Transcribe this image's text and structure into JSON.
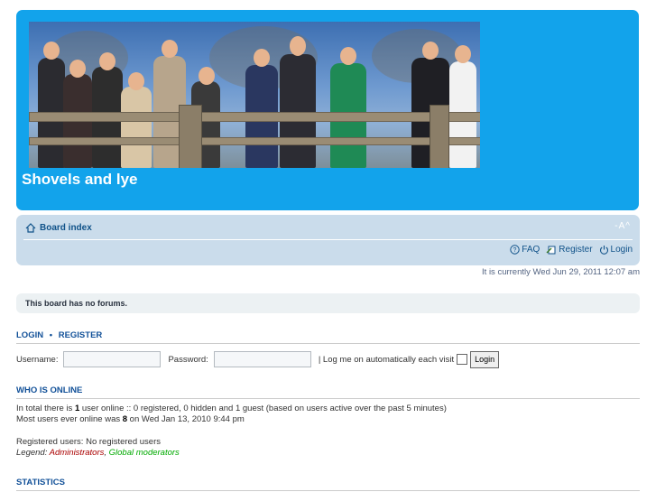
{
  "header": {
    "site_title": "Shovels and lye"
  },
  "navbar": {
    "board_index": "Board index",
    "font_sizer": "-A^",
    "faq": "FAQ",
    "register": "Register",
    "login": "Login"
  },
  "current_time": "It is currently Wed Jun 29, 2011 12:07 am",
  "no_forums": "This board has no forums.",
  "login_section": {
    "title_login": "LOGIN",
    "separator": "•",
    "title_register": "REGISTER",
    "username_label": "Username:",
    "password_label": "Password:",
    "auto_login_label": "| Log me on automatically each visit",
    "login_button": "Login"
  },
  "who_is_online": {
    "title": "WHO IS ONLINE",
    "line1_pre": "In total there is ",
    "line1_count": "1",
    "line1_post": " user online :: 0 registered, 0 hidden and 1 guest (based on users active over the past 5 minutes)",
    "line2_pre": "Most users ever online was ",
    "line2_count": "8",
    "line2_post": " on Wed Jan 13, 2010 9:44 pm",
    "registered_users": "Registered users: No registered users",
    "legend_label": "Legend: ",
    "legend_admin": "Administrators",
    "legend_sep": ", ",
    "legend_globalmod": "Global moderators"
  },
  "statistics": {
    "title": "STATISTICS"
  },
  "colors": {
    "header_bg": "#12a3eb",
    "navbar_bg": "#cadceb",
    "link": "#105289",
    "admin": "#aa0000",
    "global_mod": "#00aa00"
  }
}
